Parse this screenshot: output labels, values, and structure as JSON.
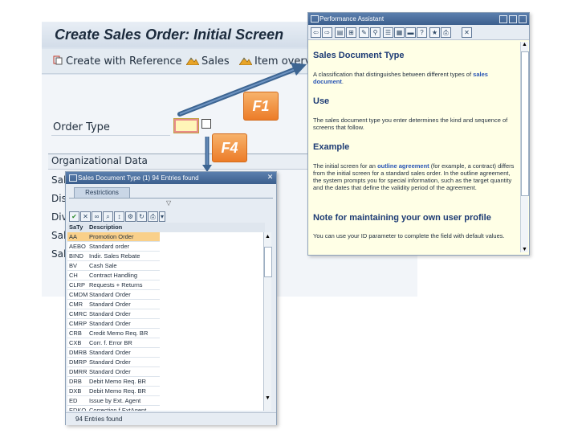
{
  "main": {
    "title": "Create Sales Order: Initial Screen",
    "toolbar": {
      "create_with_reference": "Create with Reference",
      "sales": "Sales",
      "item_overview": "Item overvie"
    },
    "order_type_label": "Order Type",
    "org_data_title": "Organizational Data",
    "org_rows": [
      "Sal",
      "Dis",
      "Div",
      "Sal",
      "Sal"
    ]
  },
  "callouts": {
    "f1": "F1",
    "f4": "F4"
  },
  "value_help": {
    "title": "Sales Document Type (1)   94 Entries found",
    "tab": "Restrictions",
    "columns": [
      "SaTy",
      "Description"
    ],
    "rows": [
      [
        "AA",
        "Promotion Order"
      ],
      [
        "AEBO",
        "Standard order"
      ],
      [
        "BIND",
        "Indir. Sales Rebate"
      ],
      [
        "BV",
        "Cash Sale"
      ],
      [
        "CH",
        "Contract Handling"
      ],
      [
        "CLRP",
        "Requests + Returns"
      ],
      [
        "CMDM",
        "Standard Order"
      ],
      [
        "CMR",
        "Standard Order"
      ],
      [
        "CMRC",
        "Standard Order"
      ],
      [
        "CMRP",
        "Standard Order"
      ],
      [
        "CRB",
        "Credit Memo Req. BR"
      ],
      [
        "CXB",
        "Corr. f. Error BR"
      ],
      [
        "DMRB",
        "Standard Order"
      ],
      [
        "DMRP",
        "Standard Order"
      ],
      [
        "DMRR",
        "Standard Order"
      ],
      [
        "DRB",
        "Debit Memo Req. BR"
      ],
      [
        "DXB",
        "Debit Memo Req. BR"
      ],
      [
        "ED",
        "Issue by Ext. Agent"
      ],
      [
        "EDKO",
        "Correction f.ExtAgent"
      ]
    ],
    "status": "94 Entries found"
  },
  "assistant": {
    "title": "Performance Assistant",
    "heading": "Sales Document Type",
    "intro_pre": "A classification that distinguishes between different types of",
    "intro_link": "sales document",
    "intro_post": ".",
    "use_heading": "Use",
    "use_text": "The sales document type you enter determines the kind and sequence of screens that follow.",
    "example_heading": "Example",
    "example_pre": "The initial screen for an",
    "example_link": "outline agreement",
    "example_post": "(for example, a contract) differs from the initial screen for a standard sales order. In the outline agreement, the system prompts you for special information, such as the target quantity and the dates that define the validity period of the agreement.",
    "note_heading": "Note for maintaining your own user profile",
    "note_text": "You can use your ID parameter to complete the field with default values."
  },
  "colors": {
    "callout": "#ec7c28",
    "arrow": "#3d6592",
    "selection": "#f9d08a",
    "assistant_bg": "#ffffe6"
  }
}
